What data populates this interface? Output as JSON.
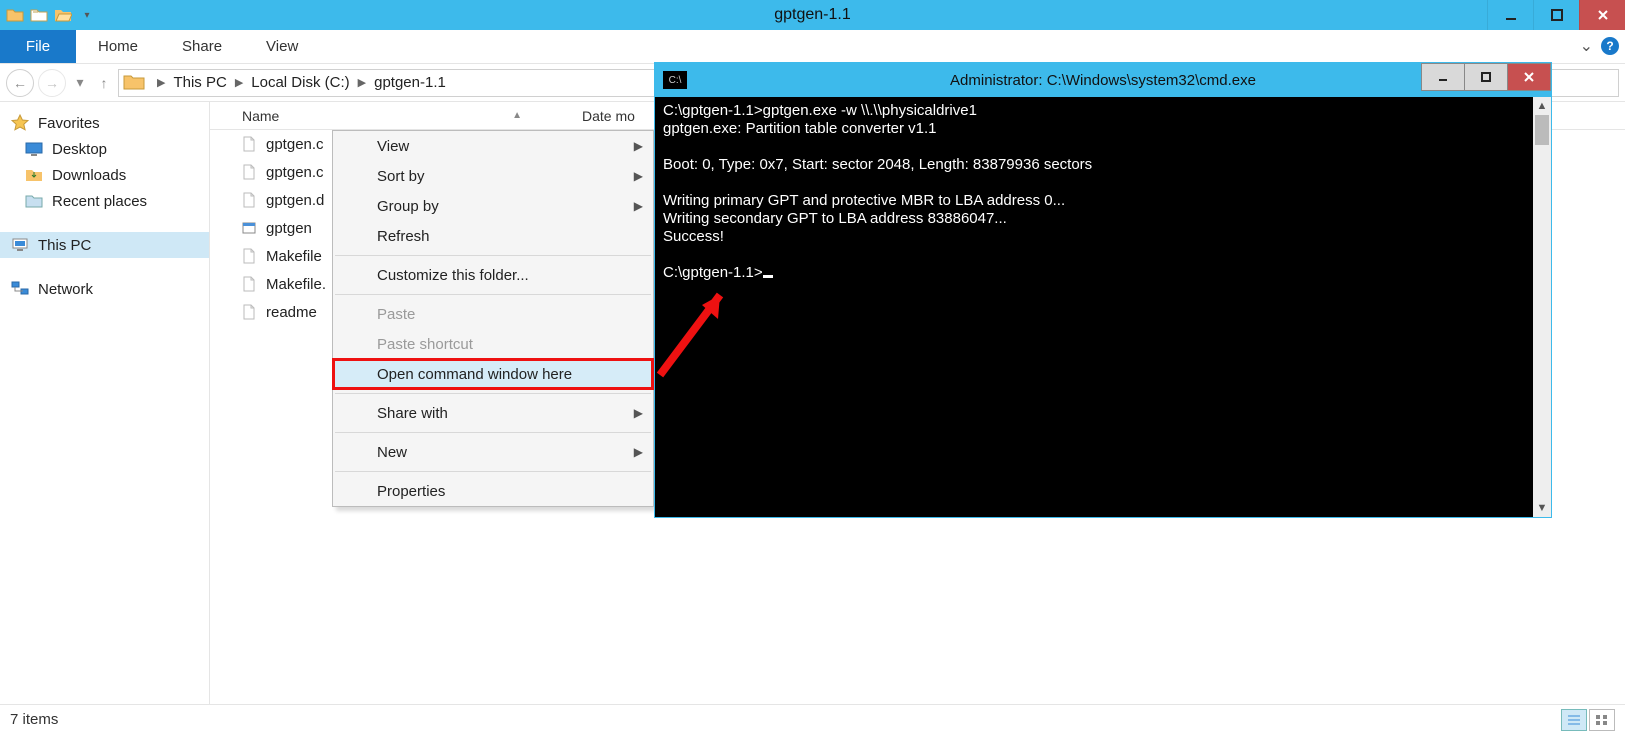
{
  "explorer": {
    "title": "gptgen-1.1",
    "ribbon": {
      "file": "File",
      "tabs": [
        "Home",
        "Share",
        "View"
      ]
    },
    "breadcrumb": [
      "This PC",
      "Local Disk (C:)",
      "gptgen-1.1"
    ],
    "nav": {
      "favorites": {
        "label": "Favorites",
        "items": [
          "Desktop",
          "Downloads",
          "Recent places"
        ]
      },
      "thispc": "This PC",
      "network": "Network"
    },
    "columns": {
      "name": "Name",
      "date": "Date mo"
    },
    "files": [
      "gptgen.c",
      "gptgen.c",
      "gptgen.d",
      "gptgen",
      "Makefile",
      "Makefile.",
      "readme"
    ],
    "status": "7 items"
  },
  "context_menu": {
    "view": "View",
    "sortby": "Sort by",
    "groupby": "Group by",
    "refresh": "Refresh",
    "customize": "Customize this folder...",
    "paste": "Paste",
    "paste_shortcut": "Paste shortcut",
    "open_cmd": "Open command window here",
    "sharewith": "Share with",
    "new": "New",
    "properties": "Properties"
  },
  "cmd": {
    "title": "Administrator: C:\\Windows\\system32\\cmd.exe",
    "lines": [
      "C:\\gptgen-1.1>gptgen.exe -w \\\\.\\\\physicaldrive1",
      "gptgen.exe: Partition table converter v1.1",
      "",
      "Boot: 0, Type: 0x7, Start: sector 2048, Length: 83879936 sectors",
      "",
      "Writing primary GPT and protective MBR to LBA address 0...",
      "Writing secondary GPT to LBA address 83886047...",
      "Success!",
      "",
      "C:\\gptgen-1.1>"
    ]
  }
}
